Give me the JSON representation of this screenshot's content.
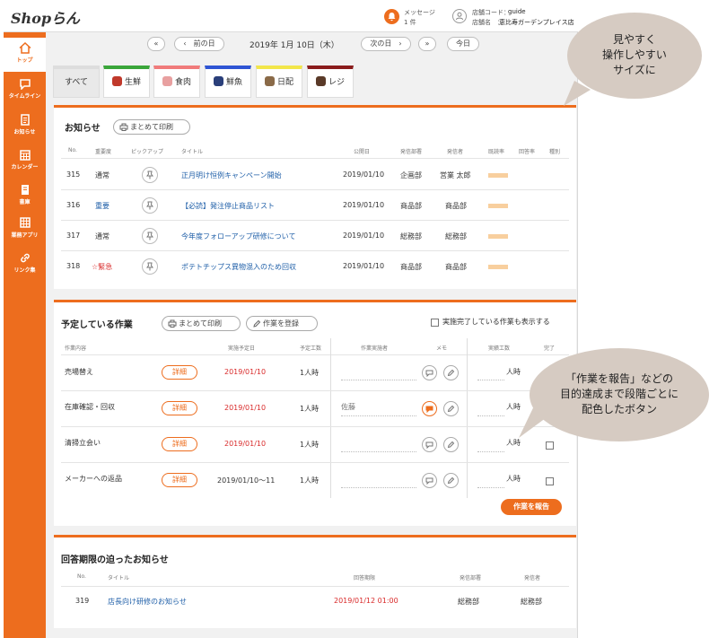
{
  "header": {
    "logo": "Shopらん",
    "message_label": "メッセージ",
    "message_count": "1 件",
    "store_code_label": "店舗コード：",
    "store_code": "guide",
    "store_name_label": "店舗名　：",
    "store_name": "恵比寿ガーデンプレイス店"
  },
  "sidebar": {
    "items": [
      {
        "label": "トップ",
        "icon": "home-icon"
      },
      {
        "label": "タイムライン",
        "icon": "chat-icon"
      },
      {
        "label": "お知らせ",
        "icon": "document-icon"
      },
      {
        "label": "カレンダー",
        "icon": "calendar-icon"
      },
      {
        "label": "書庫",
        "icon": "book-icon"
      },
      {
        "label": "業務アプリ",
        "icon": "grid-icon"
      },
      {
        "label": "リンク集",
        "icon": "link-icon"
      }
    ]
  },
  "date_nav": {
    "first": "«",
    "prev": "‹　前の日",
    "date": "2019年 1月 10日（木）",
    "next": "次の日　›",
    "last": "»",
    "today": "今日"
  },
  "categories": [
    {
      "label": "すべて",
      "color": "#dddddd"
    },
    {
      "label": "生鮮",
      "color": "#3aa63a"
    },
    {
      "label": "食肉",
      "color": "#f07b7b"
    },
    {
      "label": "鮮魚",
      "color": "#2f55d4"
    },
    {
      "label": "日配",
      "color": "#f2e64a"
    },
    {
      "label": "レジ",
      "color": "#8a1c1c"
    }
  ],
  "notices": {
    "title": "お知らせ",
    "print_all": "まとめて印刷",
    "columns": [
      "No.",
      "重要度",
      "ピックアップ",
      "タイトル",
      "公開日",
      "発信部署",
      "発信者",
      "既読率",
      "回答率",
      "種別"
    ],
    "rows": [
      {
        "no": "315",
        "importance": "通常",
        "title": "正月明け恒例キャンペーン開始",
        "date": "2019/01/10",
        "dept": "企画部",
        "sender": "営業 太郎"
      },
      {
        "no": "316",
        "importance": "重要",
        "title": "【必読】発注停止商品リスト",
        "date": "2019/01/10",
        "dept": "商品部",
        "sender": "商品部"
      },
      {
        "no": "317",
        "importance": "通常",
        "title": "今年度フォローアップ研修について",
        "date": "2019/01/10",
        "dept": "総務部",
        "sender": "総務部"
      },
      {
        "no": "318",
        "importance": "☆緊急",
        "title": "ポテトチップス異物混入のため回収",
        "date": "2019/01/10",
        "dept": "商品部",
        "sender": "商品部"
      }
    ]
  },
  "tasks": {
    "title": "予定している作業",
    "print_all": "まとめて印刷",
    "register": "作業を登録",
    "show_done": "実施完了している作業も表示する",
    "columns": [
      "作業内容",
      "実施予定日",
      "予定工数",
      "作業実施者",
      "メモ",
      "実績工数",
      "完了"
    ],
    "rows": [
      {
        "name": "売場替え",
        "detail": "詳細",
        "date": "2019/01/10",
        "hours": "1人時",
        "worker": "",
        "actual": "人時"
      },
      {
        "name": "在庫確認・回収",
        "detail": "詳細",
        "date": "2019/01/10",
        "hours": "1人時",
        "worker": "佐藤",
        "actual": "人時"
      },
      {
        "name": "清掃立会い",
        "detail": "詳細",
        "date": "2019/01/10",
        "hours": "1人時",
        "worker": "",
        "actual": "人時"
      },
      {
        "name": "メーカーへの返品",
        "detail": "詳細",
        "date": "2019/01/10〜11",
        "hours": "1人時",
        "worker": "",
        "actual": "人時"
      }
    ],
    "report": "作業を報告"
  },
  "deadline": {
    "title": "回答期限の迫ったお知らせ",
    "columns": [
      "No.",
      "タイトル",
      "回答期限",
      "発信部署",
      "発信者"
    ],
    "rows": [
      {
        "no": "319",
        "title": "店長向け研修のお知らせ",
        "deadline": "2019/01/12 01:00",
        "dept": "総務部",
        "sender": "総務部"
      }
    ]
  },
  "callouts": {
    "top": [
      "見やすく",
      "操作しやすい",
      "サイズに"
    ],
    "middle": [
      "「作業を報告」などの",
      "目的達成まで段階ごとに",
      "配色したボタン"
    ]
  },
  "colors": {
    "accent": "#ed6d1e",
    "link": "#1f5fa8",
    "alert": "#d92b2b",
    "bubble": "#d6cbc2"
  }
}
